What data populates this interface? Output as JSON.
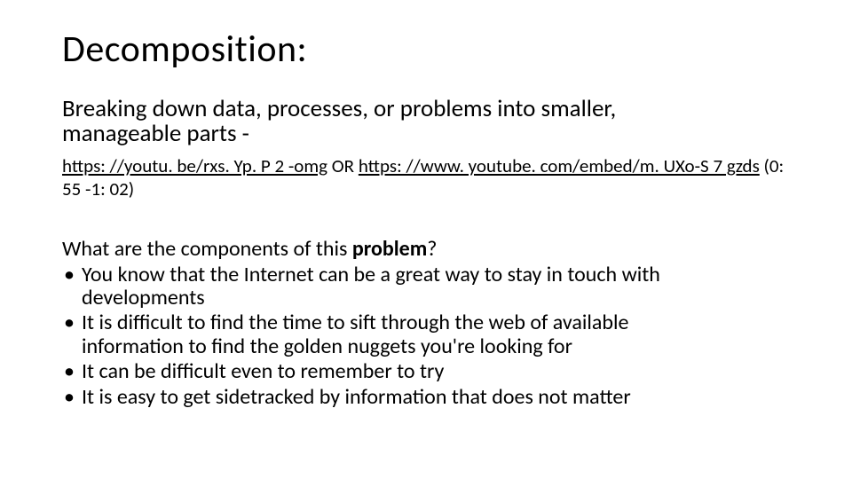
{
  "title": "Decomposition:",
  "subtitle_line1": "Breaking down data, processes, or problems into smaller,",
  "subtitle_line2": "manageable parts -",
  "link1": "https: //youtu. be/rxs. Yp. P 2 -omg",
  "or_text": " OR ",
  "link2": "https: //www. youtube. com/embed/m. UXo-S 7 gzds",
  "timestamp": " (0: 55 -1: 02)",
  "question_prefix": "What are the components of this ",
  "question_bold": "problem",
  "question_suffix": "?",
  "bullets": {
    "b0a": "You know that the Internet can be a great way to stay in touch with",
    "b0b": "developments",
    "b1a": "It is difficult to find the time to sift through the web of available",
    "b1b": "information to find the golden nuggets you're looking for",
    "b2": "It can be difficult even to remember to try",
    "b3": "It is easy to get sidetracked by information that does not matter"
  }
}
